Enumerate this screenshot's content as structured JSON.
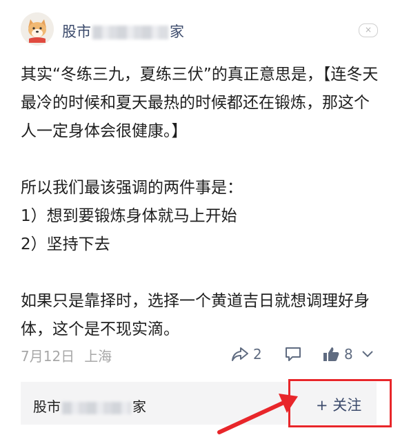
{
  "header": {
    "author_prefix": "股市",
    "author_suffix": "家",
    "close_symbol": "×"
  },
  "post": {
    "paragraphs": [
      "其实“冬练三九，夏练三伏”的真正意思是，【连冬天最冷的时候和夏天最热的时候都还在锻炼，那这个人一定身体会很健康。】",
      "所以我们最该强调的两件事是：",
      "1）想到要锻炼身体就马上开始",
      "2）坚持下去",
      "如果只是靠择时，选择一个黄道吉日就想调理好身体，这个是不现实滴。"
    ]
  },
  "meta": {
    "date": "7月12日",
    "location": "上海",
    "share_count": "2",
    "like_count": "8"
  },
  "footer": {
    "author_prefix": "股市",
    "author_suffix": "家",
    "follow_label": "+ 关注"
  },
  "icons": {
    "share": "share-icon",
    "comment": "comment-icon",
    "like": "thumbs-up-icon",
    "expand": "chevron-down-icon",
    "close": "close-icon"
  },
  "colors": {
    "author_name": "#3b4a6b",
    "meta_text": "#a7a7a7",
    "action_icon": "#5f6b80",
    "highlight": "#e8262a",
    "footer_bg": "#f4f4f5"
  }
}
